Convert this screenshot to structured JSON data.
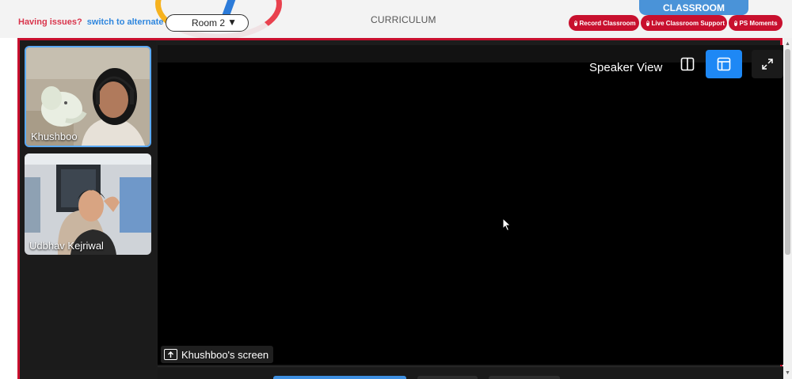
{
  "header": {
    "issue_question": "Having issues?",
    "issue_link": "switch to alternate room",
    "room_select": {
      "selected": "Room 2",
      "arrow": "▼"
    },
    "curriculum_label": "CURRICULUM",
    "classroom_tab": "CLASSROOM",
    "actions": [
      {
        "label": "Record Classroom",
        "icon": "record-icon"
      },
      {
        "label": "Live Classroom Support",
        "icon": "support-icon"
      },
      {
        "label": "PS Moments",
        "icon": "moments-icon"
      }
    ]
  },
  "participants": [
    {
      "name": "Khushboo",
      "active_speaker": true
    },
    {
      "name": "Udbhav Kejriwal",
      "active_speaker": false
    }
  ],
  "main_view": {
    "view_label": "Speaker View",
    "screen_share_label": "Khushboo's screen"
  },
  "colors": {
    "accent_red": "#c8102e",
    "accent_blue": "#1e88f5",
    "link_blue": "#2e86de",
    "classroom_tab": "#4a93d8",
    "stage_bg": "#000000"
  }
}
